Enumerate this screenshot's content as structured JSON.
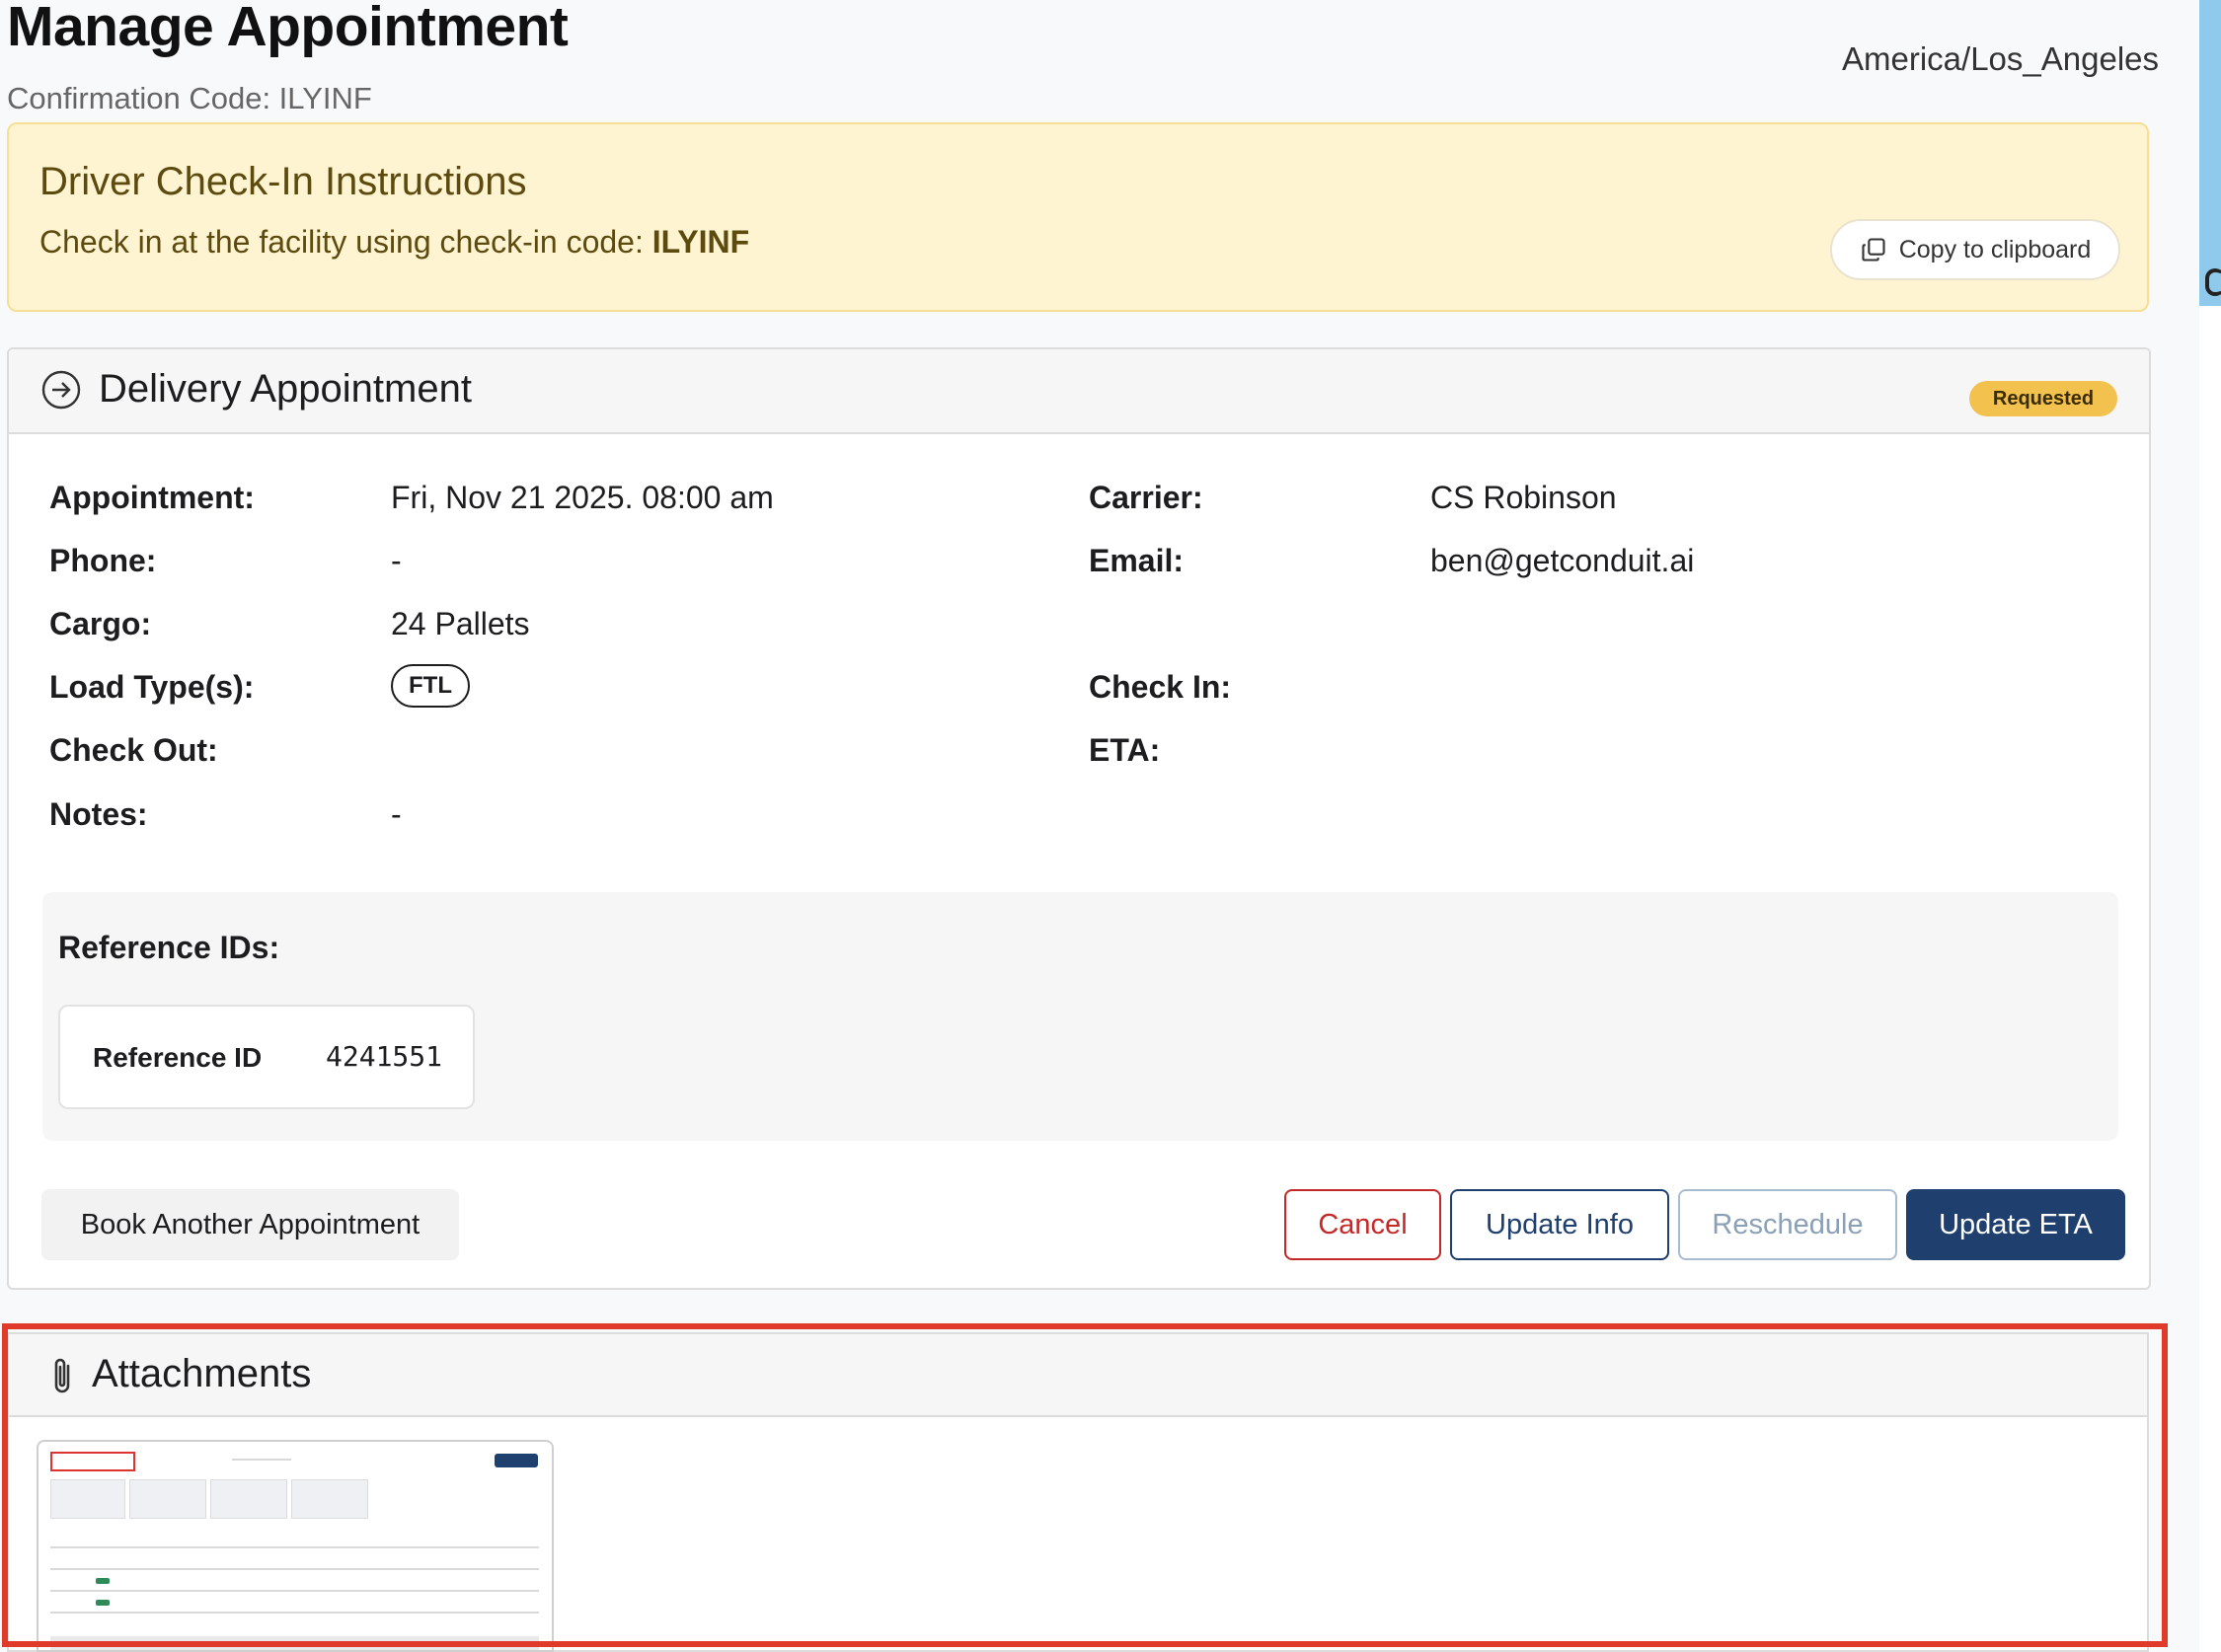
{
  "header": {
    "title": "Manage Appointment",
    "confirmation_code": "Confirmation Code: ILYINF",
    "timezone": "America/Los_Angeles"
  },
  "instructions": {
    "title": "Driver Check-In Instructions",
    "text_prefix": "Check in at the facility using check-in code: ",
    "code": "ILYINF",
    "copy_label": "Copy to clipboard"
  },
  "appointment": {
    "title": "Delivery Appointment",
    "status": "Requested",
    "status_color": "#f2c14e",
    "left": [
      {
        "label": "Appointment:",
        "value": "Fri, Nov 21 2025. 08:00 am"
      },
      {
        "label": "Phone:",
        "value": "-"
      },
      {
        "label": "Cargo:",
        "value": "24 Pallets"
      },
      {
        "label": "Load Type(s):",
        "value": "FTL"
      },
      {
        "label": "Check Out:",
        "value": ""
      },
      {
        "label": "Notes:",
        "value": "-"
      }
    ],
    "right": [
      {
        "label": "Carrier:",
        "value": "CS Robinson"
      },
      {
        "label": "Email:",
        "value": "ben@getconduit.ai"
      },
      {
        "label": "Check In:",
        "value": ""
      },
      {
        "label": "ETA:",
        "value": ""
      }
    ],
    "reference_title": "Reference IDs:",
    "reference": {
      "key": "Reference ID",
      "value": "4241551"
    },
    "buttons": {
      "book_another": "Book Another Appointment",
      "cancel": "Cancel",
      "update_info": "Update Info",
      "reschedule": "Reschedule",
      "update_eta": "Update ETA"
    }
  },
  "attachments": {
    "title": "Attachments"
  },
  "colors": {
    "primary": "#1f3f6e",
    "danger": "#c62828",
    "instructions_bg": "#fef4d1",
    "highlight": "#e03b2a"
  }
}
